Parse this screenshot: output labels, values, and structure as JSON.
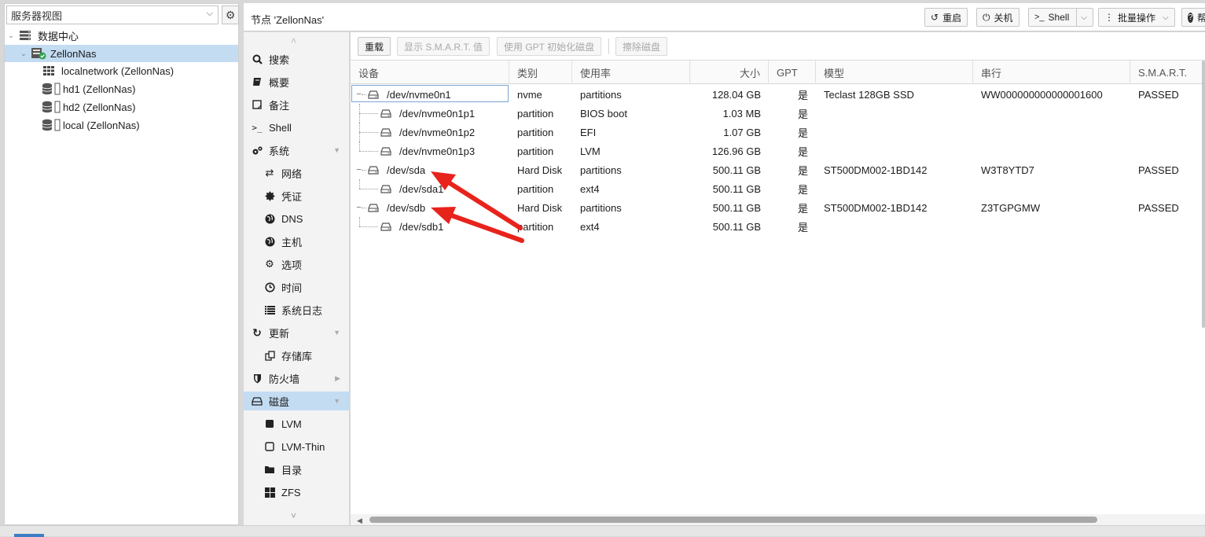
{
  "resource_tree": {
    "view_label": "服务器视图",
    "items": [
      {
        "label": "数据中心",
        "icon": "server-stack-icon",
        "depth": 0,
        "selected": false
      },
      {
        "label": "ZellonNas",
        "icon": "node-online-icon",
        "depth": 1,
        "selected": true
      },
      {
        "label": "localnetwork (ZellonNas)",
        "icon": "network-grid-icon",
        "depth": 2,
        "selected": false
      },
      {
        "label": "hd1 (ZellonNas)",
        "icon": "storage-icon",
        "depth": 2,
        "selected": false
      },
      {
        "label": "hd2 (ZellonNas)",
        "icon": "storage-icon",
        "depth": 2,
        "selected": false
      },
      {
        "label": "local (ZellonNas)",
        "icon": "storage-icon",
        "depth": 2,
        "selected": false
      }
    ]
  },
  "header": {
    "title": "节点 'ZellonNas'",
    "buttons": {
      "reboot": "重启",
      "shutdown": "关机",
      "shell": "Shell",
      "bulk": "批量操作",
      "help": "帮"
    }
  },
  "nav": {
    "items": [
      {
        "label": "搜索",
        "icon": "search-icon",
        "sub": false
      },
      {
        "label": "概要",
        "icon": "book-icon",
        "sub": false
      },
      {
        "label": "备注",
        "icon": "note-icon",
        "sub": false
      },
      {
        "label": "Shell",
        "icon": "terminal-icon",
        "sub": false
      },
      {
        "label": "系统",
        "icon": "cogs-icon",
        "sub": false,
        "expand": "down"
      },
      {
        "label": "网络",
        "icon": "exchange-icon",
        "sub": true
      },
      {
        "label": "凭证",
        "icon": "certificate-icon",
        "sub": true
      },
      {
        "label": "DNS",
        "icon": "globe-icon",
        "sub": true
      },
      {
        "label": "主机",
        "icon": "globe-icon",
        "sub": true
      },
      {
        "label": "选项",
        "icon": "gear-icon",
        "sub": true
      },
      {
        "label": "时间",
        "icon": "clock-icon",
        "sub": true
      },
      {
        "label": "系统日志",
        "icon": "list-icon",
        "sub": true
      },
      {
        "label": "更新",
        "icon": "refresh-icon",
        "sub": false,
        "expand": "down"
      },
      {
        "label": "存储库",
        "icon": "copy-icon",
        "sub": true
      },
      {
        "label": "防火墙",
        "icon": "shield-icon",
        "sub": false,
        "expand": "right"
      },
      {
        "label": "磁盘",
        "icon": "hdd-icon",
        "sub": false,
        "expand": "down",
        "selected": true
      },
      {
        "label": "LVM",
        "icon": "square-filled-icon",
        "sub": true
      },
      {
        "label": "LVM-Thin",
        "icon": "square-outline-icon",
        "sub": true
      },
      {
        "label": "目录",
        "icon": "folder-icon",
        "sub": true
      },
      {
        "label": "ZFS",
        "icon": "th-large-icon",
        "sub": true
      }
    ]
  },
  "toolbar": {
    "reload": "重载",
    "show_smart": "显示 S.M.A.R.T. 值",
    "init_gpt": "使用 GPT 初始化磁盘",
    "wipe": "擦除磁盘"
  },
  "grid": {
    "columns": {
      "device": "设备",
      "type": "类别",
      "usage": "使用率",
      "size": "大小",
      "gpt": "GPT",
      "model": "模型",
      "serial": "串行",
      "smart": "S.M.A.R.T."
    },
    "rows": [
      {
        "device": "/dev/nvme0n1",
        "level": 0,
        "type": "nvme",
        "usage": "partitions",
        "size": "128.04 GB",
        "gpt": "是",
        "model": "Teclast 128GB SSD",
        "serial": "WW000000000000001600",
        "smart": "PASSED"
      },
      {
        "device": "/dev/nvme0n1p1",
        "level": 1,
        "type": "partition",
        "usage": "BIOS boot",
        "size": "1.03 MB",
        "gpt": "是",
        "model": "",
        "serial": "",
        "smart": ""
      },
      {
        "device": "/dev/nvme0n1p2",
        "level": 1,
        "type": "partition",
        "usage": "EFI",
        "size": "1.07 GB",
        "gpt": "是",
        "model": "",
        "serial": "",
        "smart": ""
      },
      {
        "device": "/dev/nvme0n1p3",
        "level": 1,
        "type": "partition",
        "usage": "LVM",
        "size": "126.96 GB",
        "gpt": "是",
        "model": "",
        "serial": "",
        "smart": ""
      },
      {
        "device": "/dev/sda",
        "level": 0,
        "type": "Hard Disk",
        "usage": "partitions",
        "size": "500.11 GB",
        "gpt": "是",
        "model": "ST500DM002-1BD142",
        "serial": "W3T8YTD7",
        "smart": "PASSED"
      },
      {
        "device": "/dev/sda1",
        "level": 1,
        "type": "partition",
        "usage": "ext4",
        "size": "500.11 GB",
        "gpt": "是",
        "model": "",
        "serial": "",
        "smart": ""
      },
      {
        "device": "/dev/sdb",
        "level": 0,
        "type": "Hard Disk",
        "usage": "partitions",
        "size": "500.11 GB",
        "gpt": "是",
        "model": "ST500DM002-1BD142",
        "serial": "Z3TGPGMW",
        "smart": "PASSED"
      },
      {
        "device": "/dev/sdb1",
        "level": 1,
        "type": "partition",
        "usage": "ext4",
        "size": "500.11 GB",
        "gpt": "是",
        "model": "",
        "serial": "",
        "smart": ""
      }
    ]
  },
  "colors": {
    "selection": "#c4dcf2",
    "annotation_arrow": "#e8231c",
    "online_badge": "#2aa44a"
  }
}
